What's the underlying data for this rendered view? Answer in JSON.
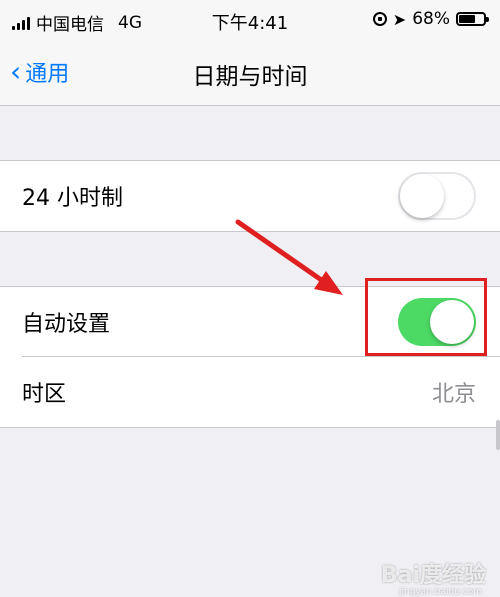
{
  "status_bar": {
    "carrier": "中国电信",
    "network": "4G",
    "time": "下午4:41",
    "battery_percent": "68%",
    "battery_level": 0.68
  },
  "nav": {
    "back_label": "通用",
    "title": "日期与时间"
  },
  "settings": {
    "hour24": {
      "label": "24 小时制",
      "on": false
    },
    "auto_set": {
      "label": "自动设置",
      "on": true
    },
    "timezone": {
      "label": "时区",
      "value": "北京"
    }
  },
  "colors": {
    "accent": "#007aff",
    "switch_on": "#4cd964",
    "annotation": "#e02020"
  },
  "watermark": {
    "brand": "Bai度经验",
    "url": "jingyan.baidu.com"
  }
}
